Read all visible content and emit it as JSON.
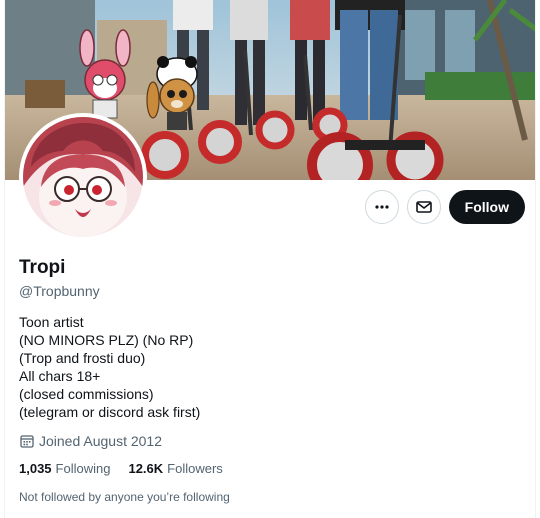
{
  "profile": {
    "display_name": "Tropi",
    "handle": "@Tropbunny",
    "bio_lines": [
      "Toon artist",
      "(NO MINORS PLZ) (No RP)",
      "(Trop and frosti duo)",
      "All chars 18+",
      "(closed commissions)",
      "(telegram or discord ask first)"
    ],
    "joined": "Joined August 2012",
    "following_count": "1,035",
    "following_label": "Following",
    "followers_count": "12.6K",
    "followers_label": "Followers",
    "followed_by_note": "Not followed by anyone you’re following"
  },
  "actions": {
    "more_icon": "more-icon",
    "message_icon": "envelope-icon",
    "follow_label": "Follow"
  },
  "icons": {
    "calendar": "calendar-icon"
  },
  "colors": {
    "text_primary": "#0f1419",
    "text_secondary": "#536471",
    "follow_bg": "#0f1419",
    "border": "#cfd9de"
  }
}
